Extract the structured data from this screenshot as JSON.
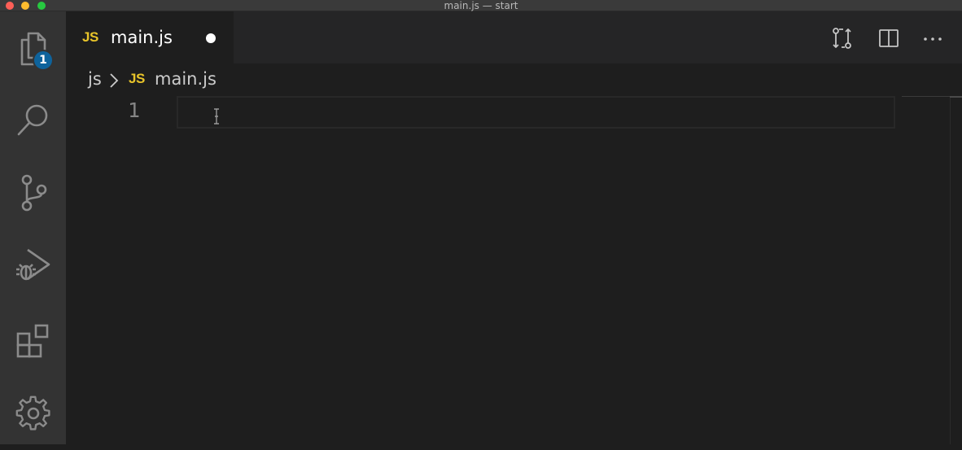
{
  "window": {
    "title": "main.js — start"
  },
  "activity_bar": {
    "items": [
      {
        "name": "explorer",
        "icon": "files-icon",
        "badge": "1"
      },
      {
        "name": "search",
        "icon": "search-icon"
      },
      {
        "name": "source-control",
        "icon": "source-control-icon"
      },
      {
        "name": "run-and-debug",
        "icon": "run-debug-icon"
      },
      {
        "name": "extensions",
        "icon": "extensions-icon"
      },
      {
        "name": "manage",
        "icon": "gear-icon"
      }
    ]
  },
  "tabs": [
    {
      "icon_text": "JS",
      "label": "main.js",
      "dirty": true,
      "active": true
    }
  ],
  "editor_actions": [
    {
      "icon": "open-changes-icon"
    },
    {
      "icon": "split-editor-icon"
    },
    {
      "icon": "more-actions-icon"
    }
  ],
  "breadcrumbs": {
    "folder": "js",
    "file_icon_text": "JS",
    "file": "main.js"
  },
  "editor": {
    "line_numbers": [
      "1"
    ],
    "content": ""
  },
  "colors": {
    "badge": "#0e639c",
    "js_icon": "#e8c42a",
    "activity_bar": "#333333",
    "editor_bg": "#1e1e1e"
  }
}
